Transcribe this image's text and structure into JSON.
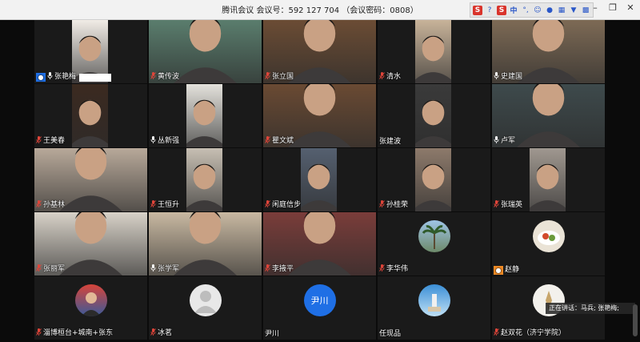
{
  "window": {
    "title": "腾讯会议 会议号：592 127 704 （会议密码：0808）",
    "tray_icons": [
      "sogou-input-icon",
      "help-icon",
      "sogou-s-icon",
      "chinese-mode-icon",
      "punctuation-icon",
      "emoji-icon",
      "microphone-icon",
      "keyboard-icon",
      "skin-shirt-icon",
      "grid-apps-icon"
    ],
    "controls": [
      "minimize",
      "restore",
      "close"
    ]
  },
  "speaking_now": "正在讲话：马兵; 张艳梅;",
  "tiles": [
    {
      "name": "张艳梅",
      "mic": "on",
      "badge": "user",
      "video": "#f1ece6"
    },
    {
      "name": "黄传波",
      "mic": "muted",
      "video": "#5a7d6d"
    },
    {
      "name": "张立国",
      "mic": "muted",
      "video": "#6b4c34"
    },
    {
      "name": "清水",
      "mic": "muted",
      "video": "#c8b39a"
    },
    {
      "name": "史建国",
      "mic": "on",
      "video": "#7d6a55"
    },
    {
      "name": "王美春",
      "mic": "muted",
      "video": "#3b2a20"
    },
    {
      "name": "丛新强",
      "mic": "on",
      "video": "#e4e2dc"
    },
    {
      "name": "瞿文斌",
      "mic": "muted",
      "video": "#6a4a33"
    },
    {
      "name": "张建波",
      "mic": "none",
      "video": "#3a3a3a"
    },
    {
      "name": "卢军",
      "mic": "on",
      "video": "#3e4a4c"
    },
    {
      "name": "孙基林",
      "mic": "muted",
      "video": "#b8a99a"
    },
    {
      "name": "王恒升",
      "mic": "muted",
      "video": "#c7bfb3"
    },
    {
      "name": "闲庭信步",
      "mic": "muted",
      "video": "#556070"
    },
    {
      "name": "孙桂荣",
      "mic": "muted",
      "video": "#8d7a6b"
    },
    {
      "name": "张瑞英",
      "mic": "muted",
      "video": "#a09890"
    },
    {
      "name": "张丽军",
      "mic": "muted",
      "video": "#d8d2c8"
    },
    {
      "name": "张学军",
      "mic": "on",
      "video": "#c9b9a2"
    },
    {
      "name": "李掖平",
      "mic": "muted",
      "video": "#7a3d3a"
    },
    {
      "name": "李华伟",
      "mic": "muted",
      "avatar": "palm",
      "video": "#2a2a2a"
    },
    {
      "name": "赵静",
      "mic": "none",
      "badge": "user-orange",
      "avatar": "food",
      "video": "#2a2a2a"
    },
    {
      "name": "淄博桓台+城南+张东",
      "mic": "muted",
      "avatar": "photo",
      "video": "#2a2a2a"
    },
    {
      "name": "冰茗",
      "mic": "muted",
      "avatar": "default",
      "video": "#2a2a2a"
    },
    {
      "name": "尹川",
      "mic": "none",
      "avatar": "text",
      "avatar_text": "尹川",
      "video": "#2a2a2a"
    },
    {
      "name": "任现品",
      "mic": "none",
      "avatar": "sky",
      "video": "#2a2a2a"
    },
    {
      "name": "赵双花（济宁学院）",
      "mic": "muted",
      "avatar": "white",
      "video": "#2a2a2a"
    }
  ],
  "colors": {
    "accent": "#1f6fe5",
    "muted": "#e0453a",
    "orange": "#f08a24"
  }
}
